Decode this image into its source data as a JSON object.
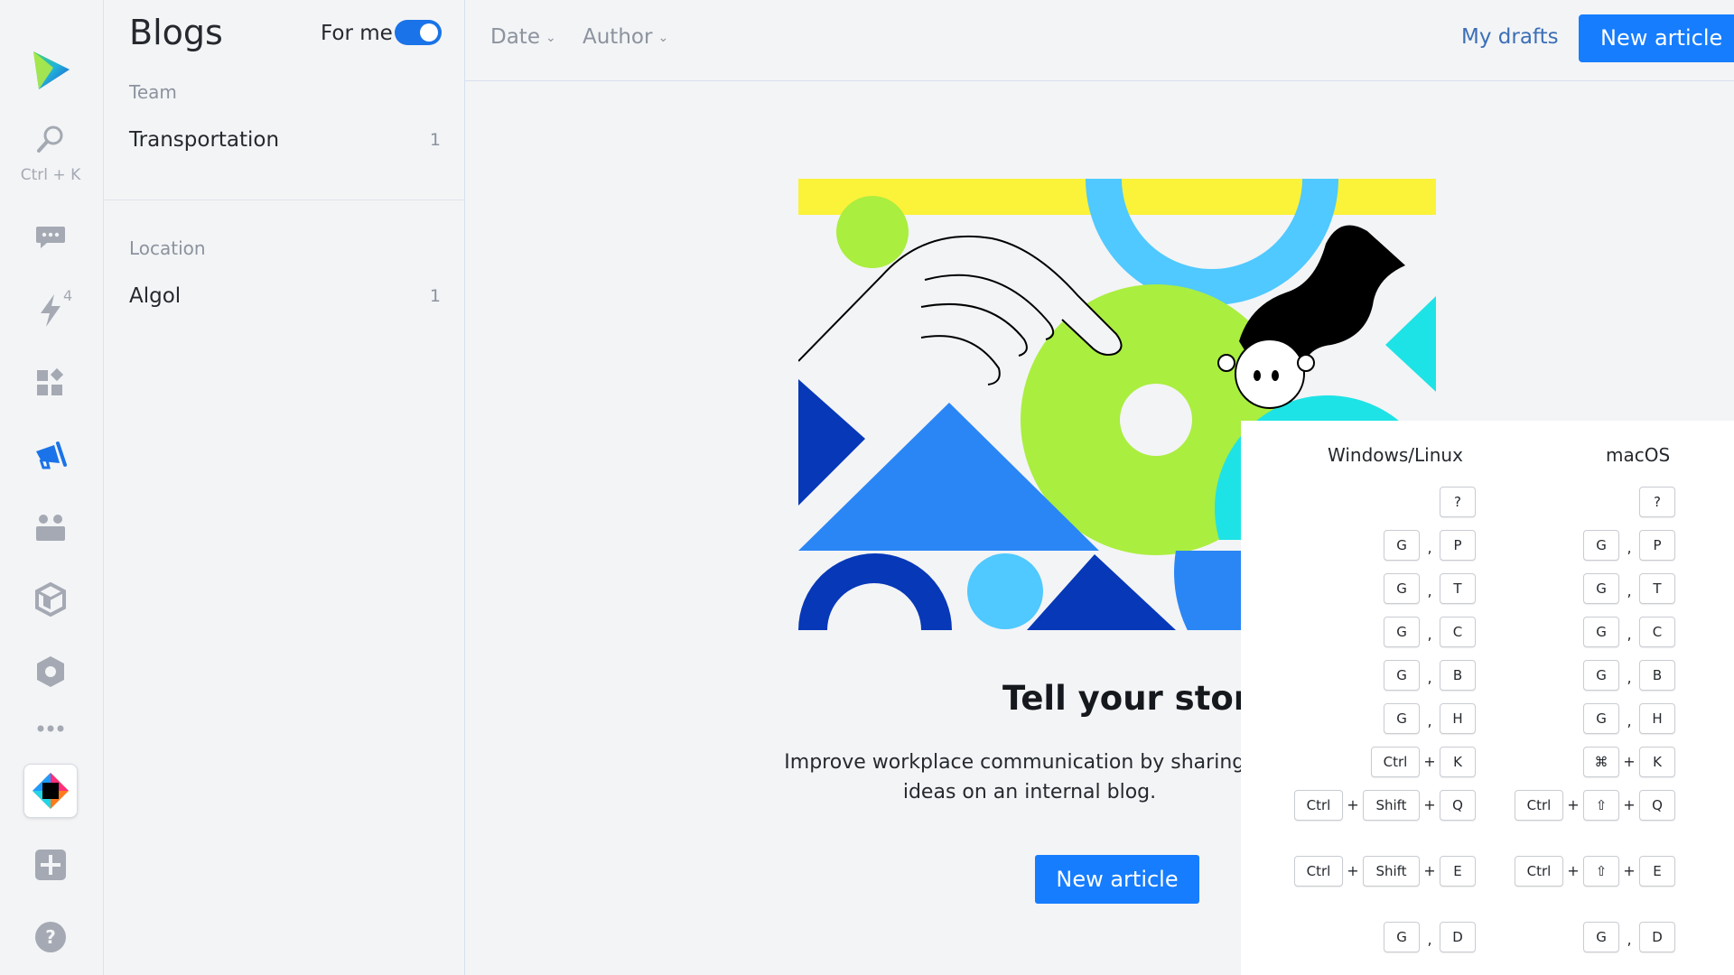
{
  "rail": {
    "search_hint": "Ctrl + K",
    "notifications_count": "4",
    "icons": [
      "app-logo-icon",
      "search-icon",
      "chat-icon",
      "lightning-icon",
      "apps-icon",
      "megaphone-icon",
      "team-icon",
      "package-icon",
      "settings-icon",
      "more-icon",
      "toolbox-app-icon",
      "add-icon",
      "help-icon"
    ]
  },
  "panel": {
    "title": "Blogs",
    "for_me_label": "For me",
    "for_me_on": true,
    "sections": [
      {
        "label": "Team",
        "items": [
          {
            "label": "Transportation",
            "count": "1"
          }
        ]
      },
      {
        "label": "Location",
        "items": [
          {
            "label": "Algol",
            "count": "1"
          }
        ]
      }
    ]
  },
  "topbar": {
    "filters": [
      "Date",
      "Author"
    ],
    "drafts_label": "My drafts",
    "new_article_label": "New article"
  },
  "main": {
    "title": "Tell your story",
    "text_line1": "Improve workplace communication by sharing yo",
    "text_line2": "ideas on an internal blog.",
    "button_label": "New article"
  },
  "shortcuts": {
    "col_windows": "Windows/Linux",
    "col_mac": "macOS",
    "rows": [
      {
        "win": [
          "?"
        ],
        "mac": [
          "?"
        ]
      },
      {
        "win": [
          "G",
          ",",
          "P"
        ],
        "mac": [
          "G",
          ",",
          "P"
        ]
      },
      {
        "win": [
          "G",
          ",",
          "T"
        ],
        "mac": [
          "G",
          ",",
          "T"
        ]
      },
      {
        "win": [
          "G",
          ",",
          "C"
        ],
        "mac": [
          "G",
          ",",
          "C"
        ]
      },
      {
        "win": [
          "G",
          ",",
          "B"
        ],
        "mac": [
          "G",
          ",",
          "B"
        ]
      },
      {
        "win": [
          "G",
          ",",
          "H"
        ],
        "mac": [
          "G",
          ",",
          "H"
        ]
      },
      {
        "win": [
          "Ctrl",
          "+",
          "K"
        ],
        "mac": [
          "⌘",
          "+",
          "K"
        ]
      },
      {
        "win": [
          "Ctrl",
          "+",
          "Shift",
          "+",
          "Q"
        ],
        "mac": [
          "Ctrl",
          "+",
          "⇧",
          "+",
          "Q"
        ]
      },
      {
        "win": [
          "Ctrl",
          "+",
          "Shift",
          "+",
          "E"
        ],
        "mac": [
          "Ctrl",
          "+",
          "⇧",
          "+",
          "E"
        ]
      },
      {
        "win": [
          "G",
          ",",
          "D"
        ],
        "mac": [
          "G",
          ",",
          "D"
        ]
      }
    ]
  },
  "colors": {
    "accent": "#167dff",
    "link": "#3b6fb6",
    "illustration_yellow": "#fbf23a",
    "illustration_lime": "#aaee3f",
    "illustration_sky": "#4fc9ff",
    "illustration_blue": "#2b86f5",
    "illustration_navy": "#0638b8",
    "illustration_cyan": "#1ee3e6"
  }
}
